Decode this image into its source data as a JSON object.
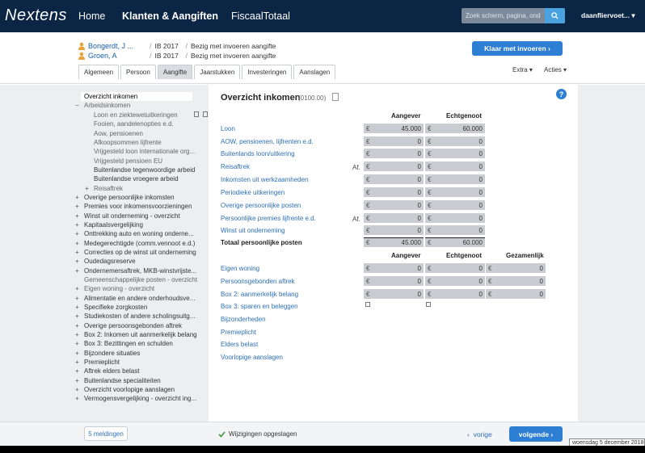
{
  "topnav": {
    "logo": "Nextens",
    "items": [
      "Home",
      "Klanten & Aangiften",
      "FiscaalTotaal"
    ],
    "search_placeholder": "Zoek scherm, pagina, onde",
    "user": "daanfliervoet..."
  },
  "clients": [
    {
      "name": "Bongerdt, J ...",
      "year": "IB 2017",
      "status": "Bezig met invoeren aangifte"
    },
    {
      "name": "Groen, A",
      "year": "IB 2017",
      "status": "Bezig met invoeren aangifte"
    }
  ],
  "ready_button": "Klaar met invoeren",
  "tabs": [
    "Algemeen",
    "Persoon",
    "Aangifte",
    "Jaarstukken",
    "Investeringen",
    "Aanslagen"
  ],
  "extra": "Extra",
  "acties": "Acties",
  "tree": {
    "selected": "Overzicht inkomen",
    "arbeid": "Arbeidsinkomen",
    "arbeid_sub": [
      "Loon en ziektewetuitkeringen",
      "Fooien, aandelenopties e.d.",
      "Aow, pensioenen",
      "Afkoopsommen lijfrente",
      "Vrijgesteld loon internationale org...",
      "Vrijgesteld pensioen EU",
      "Buitenlandse tegenwoordige arbeid",
      "Buitenlandse vroegere arbeid"
    ],
    "reisaftrek": "Reisaftrek",
    "items": [
      "Overige persoonlijke inkomsten",
      "Premies voor inkomensvoorzieningen",
      "Winst uit onderneming - overzicht",
      "Kapitaalsvergelijking",
      "Onttrekking auto en woning onderne...",
      "Medegerechtigde (comm.vennoot e.d.)",
      "Correcties op de winst uit onderneming",
      "Oudedagsreserve",
      "Ondernemersaftrek, MKB-winstvrijste...",
      "Gemeenschappelijke posten - overzicht",
      "Eigen woning - overzicht",
      "Alimentatie en andere onderhoudsve...",
      "Specifieke zorgkosten",
      "Studiekosten of andere scholingsuitg...",
      "Overige persoonsgebonden aftrek",
      "Box 2: Inkomen uit aanmerkelijk belang",
      "Box 3: Bezittingen en schulden",
      "Bijzondere situaties",
      "Premieplicht",
      "Aftrek elders belast",
      "Buitenlandse specialiteiten",
      "Overzicht voorlopige aanslagen",
      "Vermogensvergelijking - overzicht ing..."
    ]
  },
  "main": {
    "title": "Overzicht inkomen",
    "code": "(0100.00)",
    "col_aangever": "Aangever",
    "col_echtgenoot": "Echtgenoot",
    "col_gezamenlijk": "Gezamenlijk",
    "currency": "€",
    "af_label": "Af.",
    "rows1": [
      {
        "label": "Loon",
        "a": "45.000",
        "e": "60.000",
        "af": ""
      },
      {
        "label": "AOW, pensioenen, lijfrenten e.d.",
        "a": "0",
        "e": "0",
        "af": ""
      },
      {
        "label": "Buitenlands loon/uitkering",
        "a": "0",
        "e": "0",
        "af": ""
      },
      {
        "label": "Reisaftrek",
        "a": "0",
        "e": "0",
        "af": "Af."
      },
      {
        "label": "Inkomsten uit werkzaamheden",
        "a": "0",
        "e": "0",
        "af": ""
      },
      {
        "label": "Periodieke uitkeringen",
        "a": "0",
        "e": "0",
        "af": ""
      },
      {
        "label": "Overige persoonlijke posten",
        "a": "0",
        "e": "0",
        "af": ""
      },
      {
        "label": "Persoonlijke premies lijfrente e.d.",
        "a": "0",
        "e": "0",
        "af": "Af."
      },
      {
        "label": "Winst uit onderneming",
        "a": "0",
        "e": "0",
        "af": ""
      }
    ],
    "total": {
      "label": "Totaal persoonlijke posten",
      "a": "45.000",
      "e": "60.000"
    },
    "rows2": [
      {
        "label": "Eigen woning",
        "a": "0",
        "e": "0",
        "g": "0"
      },
      {
        "label": "Persoonsgebonden aftrek",
        "a": "0",
        "e": "0",
        "g": "0"
      },
      {
        "label": "Box 2: aanmerkelijk belang",
        "a": "0",
        "e": "0",
        "g": "0"
      }
    ],
    "box3": "Box 3: sparen en beleggen",
    "links": [
      "Bijzonderheden",
      "Premieplicht",
      "Elders belast",
      "Voorlopige aanslagen"
    ]
  },
  "footer": {
    "meldingen": "5 meldingen",
    "saved": "Wijzigingen opgeslagen",
    "vorige": "vorige",
    "volgende": "volgende",
    "date": "woensdag 5 december 2018"
  }
}
